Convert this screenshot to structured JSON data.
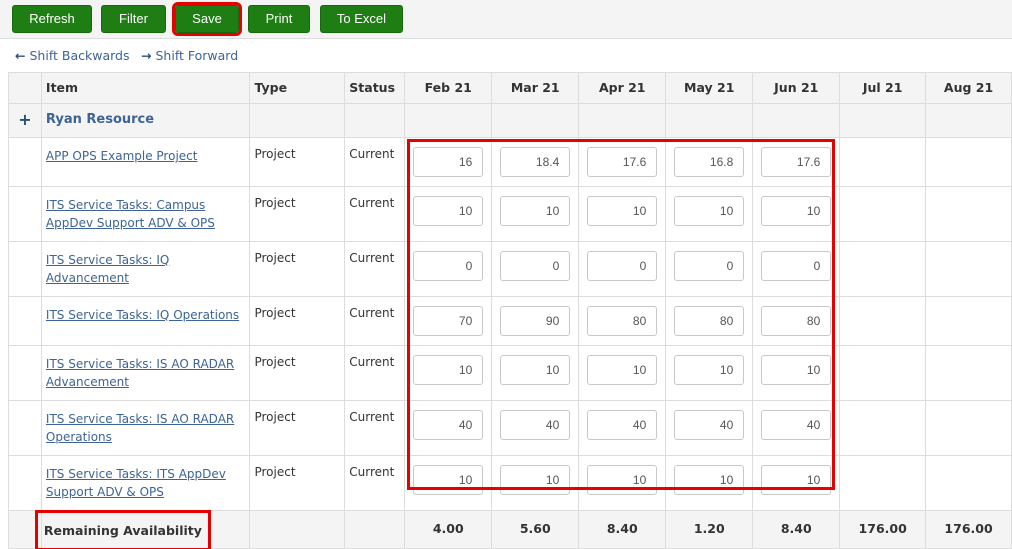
{
  "toolbar": {
    "buttons": [
      {
        "label": "Refresh"
      },
      {
        "label": "Filter"
      },
      {
        "label": "Save",
        "highlighted": true
      },
      {
        "label": "Print"
      },
      {
        "label": "To Excel"
      }
    ]
  },
  "nav": {
    "shift_backwards": "Shift Backwards",
    "shift_forward": "Shift Forward",
    "back_icon": "arrow-left-icon",
    "forward_icon": "arrow-right-icon"
  },
  "colors": {
    "button_green": "#1e7e14",
    "link_blue": "#3d6494",
    "highlight_red": "#e60000",
    "header_bg": "#f4f4f4"
  },
  "table": {
    "headers": {
      "item": "Item",
      "type": "Type",
      "status": "Status",
      "months": [
        "Feb 21",
        "Mar 21",
        "Apr 21",
        "May 21",
        "Jun 21",
        "Jul 21",
        "Aug 21"
      ]
    },
    "group": {
      "expand_icon": "+",
      "name": "Ryan Resource"
    },
    "rows": [
      {
        "item": "APP OPS Example Project",
        "type": "Project",
        "status": "Current",
        "values": [
          "16",
          "18.4",
          "17.6",
          "16.8",
          "17.6"
        ]
      },
      {
        "item": "ITS Service Tasks: Campus AppDev Support ADV & OPS",
        "type": "Project",
        "status": "Current",
        "values": [
          "10",
          "10",
          "10",
          "10",
          "10"
        ]
      },
      {
        "item": "ITS Service Tasks: IQ Advancement",
        "type": "Project",
        "status": "Current",
        "values": [
          "0",
          "0",
          "0",
          "0",
          "0"
        ]
      },
      {
        "item": "ITS Service Tasks: IQ Operations",
        "type": "Project",
        "status": "Current",
        "values": [
          "70",
          "90",
          "80",
          "80",
          "80"
        ]
      },
      {
        "item": "ITS Service Tasks: IS AO RADAR Advancement",
        "type": "Project",
        "status": "Current",
        "values": [
          "10",
          "10",
          "10",
          "10",
          "10"
        ]
      },
      {
        "item": "ITS Service Tasks: IS AO RADAR Operations",
        "type": "Project",
        "status": "Current",
        "values": [
          "40",
          "40",
          "40",
          "40",
          "40"
        ]
      },
      {
        "item": "ITS Service Tasks: ITS AppDev Support ADV & OPS",
        "type": "Project",
        "status": "Current",
        "values": [
          "10",
          "10",
          "10",
          "10",
          "10"
        ]
      }
    ],
    "total": {
      "label": "Remaining Availability",
      "values": [
        "4.00",
        "5.60",
        "8.40",
        "1.20",
        "8.40",
        "176.00",
        "176.00"
      ]
    }
  }
}
